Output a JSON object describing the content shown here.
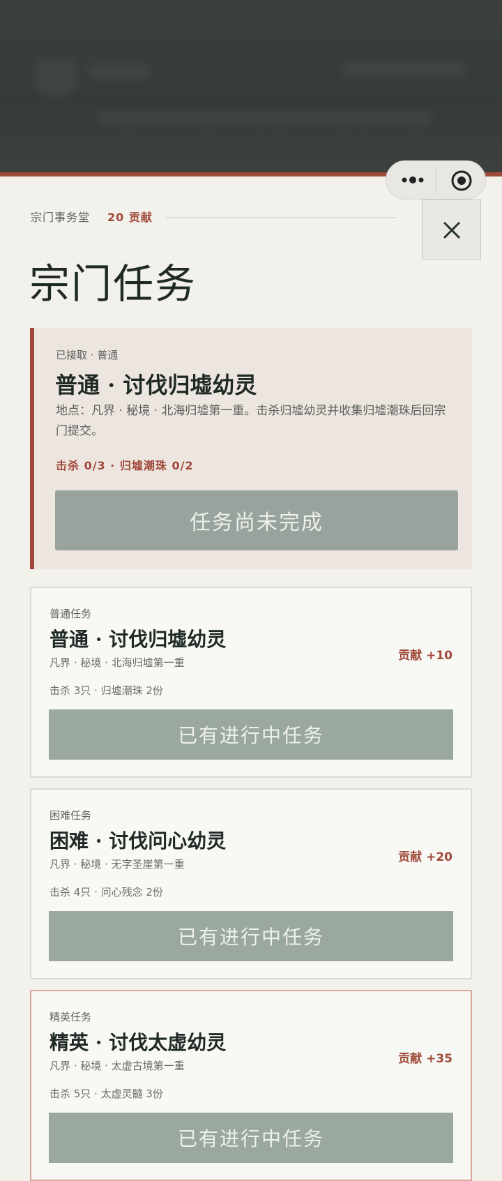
{
  "header": {
    "hall_label": "宗门事务堂",
    "contribution": "20 贡献",
    "close_icon": "close-icon"
  },
  "page_title": "宗门任务",
  "active_task": {
    "status": "已接取 · 普通",
    "title": "普通 · 讨伐归墟幼灵",
    "description": "地点：凡界 · 秘境 · 北海归墟第一重。击杀归墟幼灵并收集归墟潮珠后回宗门提交。",
    "progress": "击杀 0/3 · 归墟潮珠 0/2",
    "button_label": "任务尚未完成"
  },
  "tasks": [
    {
      "kind": "普通任务",
      "title": "普通 · 讨伐归墟幼灵",
      "location": "凡界 · 秘境 · 北海归墟第一重",
      "requirements": "击杀 3只 · 归墟潮珠 2份",
      "reward": "贡献 +10",
      "button_label": "已有进行中任务"
    },
    {
      "kind": "困难任务",
      "title": "困难 · 讨伐问心幼灵",
      "location": "凡界 · 秘境 · 无字圣崖第一重",
      "requirements": "击杀 4只 · 问心残念 2份",
      "reward": "贡献 +20",
      "button_label": "已有进行中任务"
    },
    {
      "kind": "精英任务",
      "title": "精英 · 讨伐太虚幼灵",
      "location": "凡界 · 秘境 · 太虚古境第一重",
      "requirements": "击杀 5只 · 太虚灵髓 3份",
      "reward": "贡献 +35",
      "button_label": "已有进行中任务"
    }
  ],
  "colors": {
    "accent": "#a04a3a",
    "button_disabled": "#9aa8a0",
    "backdrop": "#3a3f3d"
  }
}
